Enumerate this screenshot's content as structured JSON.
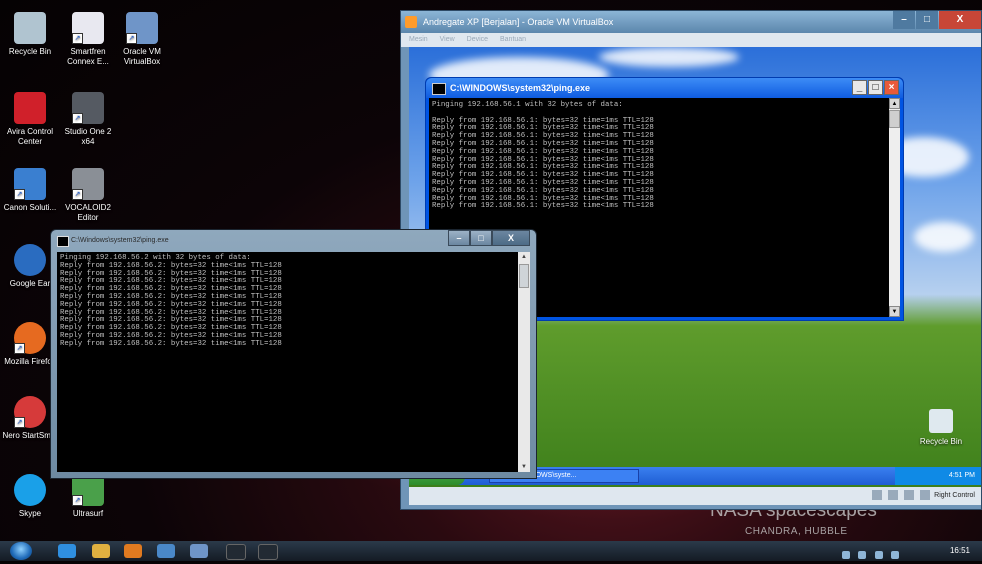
{
  "wallpaper": {
    "caption": "NASA spacescapes",
    "credit": "CHANDRA, HUBBLE"
  },
  "desktop_icons": [
    {
      "label": "Recycle Bin",
      "color": "#b0c4d0"
    },
    {
      "label": "Smartfren Connex E...",
      "color": "#e8e8f0"
    },
    {
      "label": "Oracle VM VirtualBox",
      "color": "#6f95c8"
    },
    {
      "label": "Avira Control Center",
      "color": "#d0202a"
    },
    {
      "label": "Studio One 2 x64",
      "color": "#555a62"
    },
    {
      "label": "Canon Soluti...",
      "color": "#3a7fd0"
    },
    {
      "label": "VOCALOID2 Editor",
      "color": "#8a8f96"
    },
    {
      "label": "Google Ear",
      "color": "#2a6cc0"
    },
    {
      "label": "Mozilla Firefox",
      "color": "#e66a20"
    },
    {
      "label": "Nero StartSm...",
      "color": "#d63a3a"
    },
    {
      "label": "Skype",
      "color": "#1aa0e8"
    },
    {
      "label": "Ultrasurf",
      "color": "#4aa04a"
    }
  ],
  "vbox": {
    "title": "Andregate XP [Berjalan] - Oracle VM VirtualBox",
    "menu": [
      "Mesin",
      "View",
      "Device",
      "Bantuan"
    ],
    "min": "–",
    "max": "□",
    "close": "X",
    "status_right": "Right Control"
  },
  "xp_console": {
    "title": "C:\\WINDOWS\\system32\\ping.exe",
    "text": "Pinging 192.168.56.1 with 32 bytes of data:\n\nReply from 192.168.56.1: bytes=32 time=1ms TTL=128\nReply from 192.168.56.1: bytes=32 time<1ms TTL=128\nReply from 192.168.56.1: bytes=32 time<1ms TTL=128\nReply from 192.168.56.1: bytes=32 time=1ms TTL=128\nReply from 192.168.56.1: bytes=32 time<1ms TTL=128\nReply from 192.168.56.1: bytes=32 time<1ms TTL=128\nReply from 192.168.56.1: bytes=32 time<1ms TTL=128\nReply from 192.168.56.1: bytes=32 time<1ms TTL=128\nReply from 192.168.56.1: bytes=32 time<1ms TTL=128\nReply from 192.168.56.1: bytes=32 time<1ms TTL=128\nReply from 192.168.56.1: bytes=32 time<1ms TTL=128\nReply from 192.168.56.1: bytes=32 time<1ms TTL=128",
    "min": "_",
    "max": "□",
    "close": "×"
  },
  "xp_taskbar": {
    "start": "start",
    "task": "C:\\WINDOWS\\syste...",
    "clock": "4:51 PM"
  },
  "guest_recycle": "Recycle Bin",
  "w7_console": {
    "title": "C:\\Windows\\system32\\ping.exe",
    "text": "Pinging 192.168.56.2 with 32 bytes of data:\nReply from 192.168.56.2: bytes=32 time<1ms TTL=128\nReply from 192.168.56.2: bytes=32 time<1ms TTL=128\nReply from 192.168.56.2: bytes=32 time<1ms TTL=128\nReply from 192.168.56.2: bytes=32 time<1ms TTL=128\nReply from 192.168.56.2: bytes=32 time<1ms TTL=128\nReply from 192.168.56.2: bytes=32 time<1ms TTL=128\nReply from 192.168.56.2: bytes=32 time<1ms TTL=128\nReply from 192.168.56.2: bytes=32 time<1ms TTL=128\nReply from 192.168.56.2: bytes=32 time<1ms TTL=128\nReply from 192.168.56.2: bytes=32 time<1ms TTL=128\nReply from 192.168.56.2: bytes=32 time<1ms TTL=128",
    "min": "–",
    "max": "□",
    "close": "X"
  },
  "taskbar": {
    "clock": "16:51",
    "apps": [
      {
        "name": "ie-icon",
        "color": "#2f8fe0"
      },
      {
        "name": "explorer-icon",
        "color": "#e0b040"
      },
      {
        "name": "media-player-icon",
        "color": "#e07a20"
      },
      {
        "name": "app-icon",
        "color": "#4a88c8"
      },
      {
        "name": "virtualbox-icon",
        "color": "#6f95c8"
      },
      {
        "name": "cmd-icon-1",
        "color": "#222a33"
      },
      {
        "name": "cmd-icon-2",
        "color": "#222a33"
      }
    ]
  }
}
